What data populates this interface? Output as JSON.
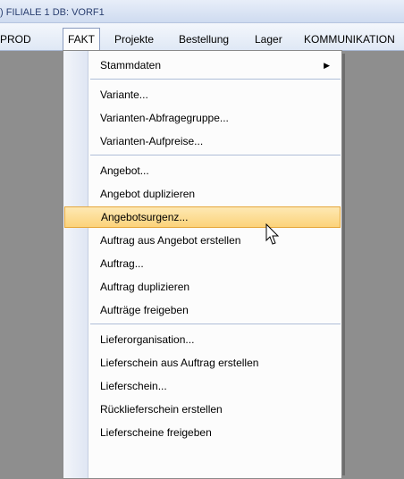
{
  "window": {
    "title": ") FILIALE 1 DB: VORF1"
  },
  "menubar": {
    "prod": "PROD",
    "fakt": "FAKT",
    "projekte": "Projekte",
    "bestellung": "Bestellung",
    "lager": "Lager",
    "kommunikation": "KOMMUNIKATION"
  },
  "menu": {
    "items": [
      "Stammdaten",
      "Variante...",
      "Varianten-Abfragegruppe...",
      "Varianten-Aufpreise...",
      "Angebot...",
      "Angebot duplizieren",
      "Angebotsurgenz...",
      "Auftrag aus Angebot erstellen",
      "Auftrag...",
      "Auftrag duplizieren",
      "Aufträge freigeben",
      "Lieferorganisation...",
      "Lieferschein aus Auftrag erstellen",
      "Lieferschein...",
      "Rücklieferschein erstellen",
      "Lieferscheine freigeben"
    ],
    "highlighted": "Angebotsurgenz...",
    "submenu_arrow": "▶"
  }
}
